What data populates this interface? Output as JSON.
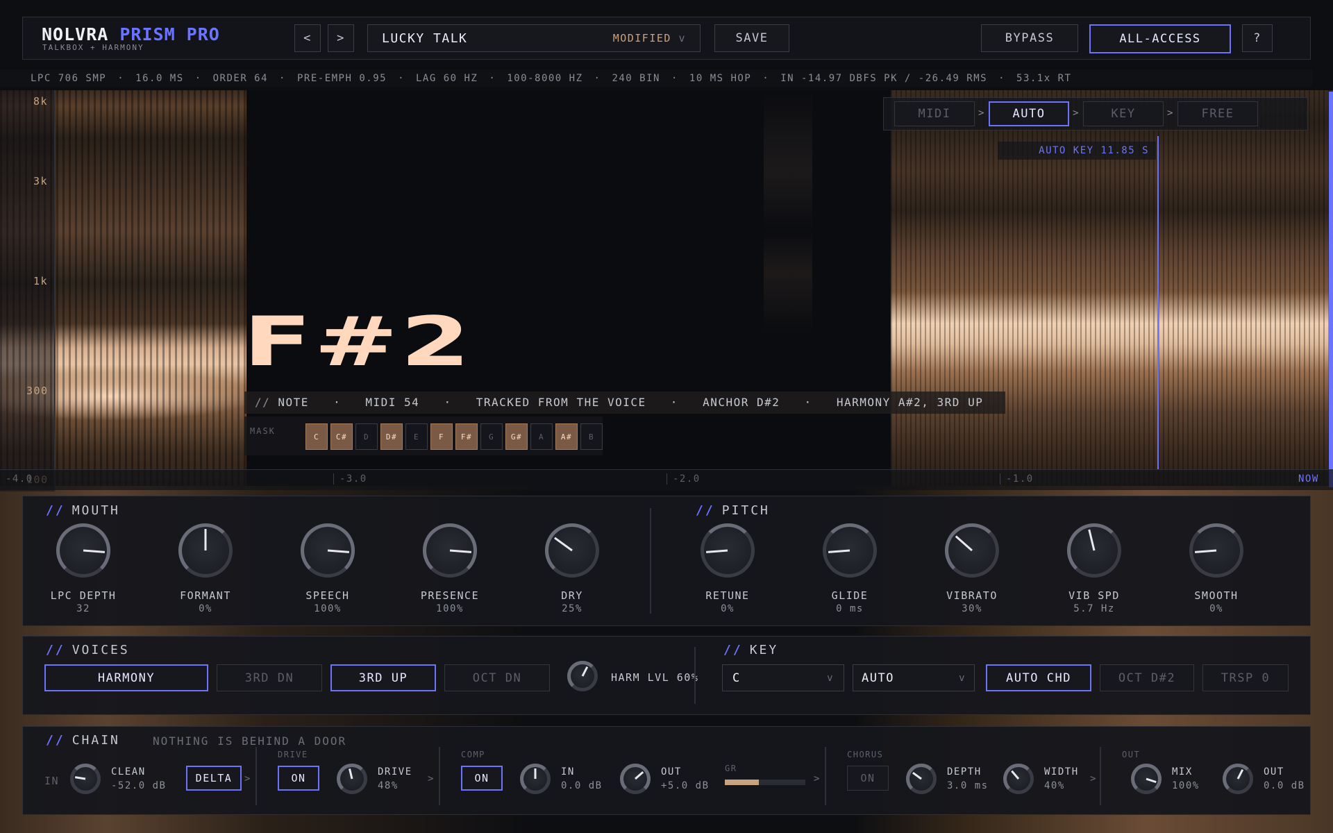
{
  "header": {
    "brand": "NOLVRA",
    "product": "PRISM PRO",
    "tagline": "TALKBOX + HARMONY",
    "prev": "<",
    "next": ">",
    "preset_name": "LUCKY TALK",
    "preset_state": "MODIFIED",
    "preset_caret": "v",
    "save": "SAVE",
    "bypass": "BYPASS",
    "all_access": "ALL-ACCESS",
    "help": "?"
  },
  "stats": [
    "LPC 706 SMP",
    "16.0 MS",
    "ORDER 64",
    "PRE-EMPH 0.95",
    "LAG 60 HZ",
    "100-8000 HZ",
    "240 BIN",
    "10 MS HOP",
    "IN -14.97 DBFS PK / -26.49 RMS",
    "53.1x RT"
  ],
  "stats_sep": "·",
  "modes": {
    "items": [
      "MIDI",
      "AUTO",
      "KEY",
      "FREE"
    ],
    "active": "AUTO",
    "sep": ">"
  },
  "auto_key": "AUTO KEY 11.85 S",
  "freq_axis": [
    "8k",
    "3k",
    "1k",
    "300",
    "100"
  ],
  "time_axis": [
    "-4.0",
    "-3.0",
    "-2.0",
    "-1.0",
    "NOW"
  ],
  "note": {
    "name": "F#2",
    "prefix": "//",
    "label": "NOTE",
    "midi": "MIDI 54",
    "source": "TRACKED FROM THE VOICE",
    "anchor": "ANCHOR D#2",
    "harmony": "HARMONY A#2, 3RD UP",
    "sep": "·"
  },
  "mask": {
    "label": "MASK",
    "keys": [
      {
        "k": "C",
        "on": true
      },
      {
        "k": "C#",
        "on": true
      },
      {
        "k": "D",
        "on": false
      },
      {
        "k": "D#",
        "on": true
      },
      {
        "k": "E",
        "on": false
      },
      {
        "k": "F",
        "on": true
      },
      {
        "k": "F#",
        "on": true
      },
      {
        "k": "G",
        "on": false
      },
      {
        "k": "G#",
        "on": true
      },
      {
        "k": "A",
        "on": false
      },
      {
        "k": "A#",
        "on": true
      },
      {
        "k": "B",
        "on": false
      }
    ]
  },
  "mouth": {
    "title": "MOUTH",
    "knobs": [
      {
        "label": "LPC DEPTH",
        "value": "32",
        "level": 0.85
      },
      {
        "label": "FORMANT",
        "value": "0%",
        "level": 0.5
      },
      {
        "label": "SPEECH",
        "value": "100%",
        "level": 0.85
      },
      {
        "label": "PRESENCE",
        "value": "100%",
        "level": 0.85
      },
      {
        "label": "DRY",
        "value": "25%",
        "level": 0.3
      }
    ]
  },
  "pitch": {
    "title": "PITCH",
    "knobs": [
      {
        "label": "RETUNE",
        "value": "0%",
        "level": 0.15
      },
      {
        "label": "GLIDE",
        "value": "0 ms",
        "level": 0.15
      },
      {
        "label": "VIBRATO",
        "value": "30%",
        "level": 0.32
      },
      {
        "label": "VIB SPD",
        "value": "5.7 Hz",
        "level": 0.45
      },
      {
        "label": "SMOOTH",
        "value": "0%",
        "level": 0.15
      }
    ]
  },
  "voices": {
    "title": "VOICES",
    "harmony": "HARMONY",
    "third_dn": "3RD DN",
    "third_up": "3RD UP",
    "oct_dn": "OCT DN",
    "harm_lvl": "HARM LVL 60%",
    "harm_level": 0.6
  },
  "key": {
    "title": "KEY",
    "root": "C",
    "scale": "AUTO",
    "caret": "v",
    "auto_chd": "AUTO CHD",
    "oct": "OCT D#2",
    "trsp": "TRSP 0"
  },
  "chain": {
    "title": "CHAIN",
    "subtitle": "NOTHING IS BEHIND A DOOR",
    "in": "IN",
    "clean_label": "CLEAN",
    "clean_value": "-52.0 dB",
    "delta": "DELTA",
    "drive_group": "DRIVE",
    "drive_on": "ON",
    "drive_label": "DRIVE",
    "drive_value": "48%",
    "comp_group": "COMP",
    "comp_on": "ON",
    "comp_in_label": "IN",
    "comp_in_value": "0.0 dB",
    "comp_out_label": "OUT",
    "comp_out_value": "+5.0 dB",
    "gr": "GR",
    "gr_level": 0.42,
    "chorus_group": "CHORUS",
    "chorus_on": "ON",
    "depth_label": "DEPTH",
    "depth_value": "3.0 ms",
    "width_label": "WIDTH",
    "width_value": "40%",
    "out_group": "OUT",
    "mix_label": "MIX",
    "mix_value": "100%",
    "out_label": "OUT",
    "out_value": "0.0 dB",
    "arrow": ">"
  },
  "colors": {
    "accent": "#6b74ff",
    "warm": "#c9a27f",
    "panel": "#16171c"
  }
}
